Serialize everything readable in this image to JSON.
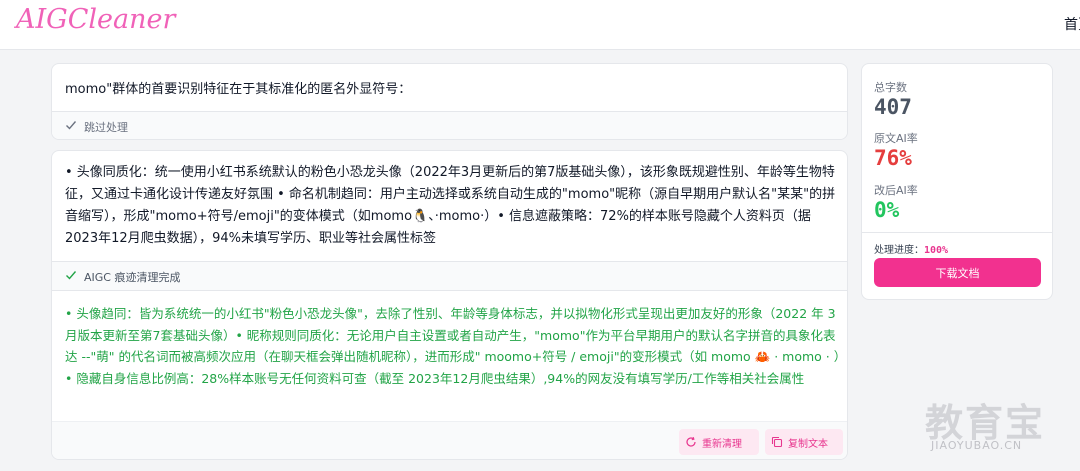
{
  "brand": {
    "logo_text": "AIGCleaner",
    "logo_color": "#f062b8"
  },
  "nav": {
    "home_label": "首页"
  },
  "segments": [
    {
      "original": "momo\"群体的首要识别特征在于其标准化的匿名外显符号：",
      "status": "跳过处理"
    },
    {
      "original": "• 头像同质化：统一使用小红书系统默认的粉色小恐龙头像（2022年3月更新后的第7版基础头像），该形象既规避性别、年龄等生物特征，又通过卡通化设计传递友好氛围 • 命名机制趋同：用户主动选择或系统自动生成的\"momo\"昵称（源自早期用户默认名\"某某\"的拼音缩写），形成\"momo+符号/emoji\"的变体模式（如momo🐧、·momo·）• 信息遮蔽策略：72%的样本账号隐藏个人资料页（据2023年12月爬虫数据），94%未填写学历、职业等社会属性标签",
      "status": "AIGC 痕迹清理完成",
      "cleaned": "• 头像趋同：皆为系统统一的小红书\"粉色小恐龙头像\"，去除了性别、年龄等身体标志，并以拟物化形式呈现出更加友好的形象（2022 年 3 月版本更新至第7套基础头像）• 昵称规则同质化：无论用户自主设置或者自动产生，\"momo\"作为平台早期用户的默认名字拼音的具象化表达 --\"萌\" 的代名词而被高频次应用（在聊天框会弹出随机昵称），进而形成\" moomo+符号 / emoji\"的变形模式（如 momo 🦀 · momo · ）• 隐藏自身信息比例高：28%样本账号无任何资料可查（截至 2023年12月爬虫结果）,94%的网友没有填写学历/工作等相关社会属性",
      "actions": {
        "reclean": "重新清理",
        "copy": "复制文本"
      }
    }
  ],
  "stats": {
    "total_chars_label": "总字数",
    "total_chars": "407",
    "orig_ai_label": "原文AI率",
    "orig_ai": "76%",
    "orig_ai_color": "#e53e3e",
    "new_ai_label": "改后AI率",
    "new_ai": "0%",
    "new_ai_color": "#22c55e",
    "progress_label": "处理进度：",
    "progress": "100%",
    "download_label": "下载文档"
  },
  "watermark": {
    "big": "教育宝",
    "small": "JIAOYUBAO.CN"
  }
}
